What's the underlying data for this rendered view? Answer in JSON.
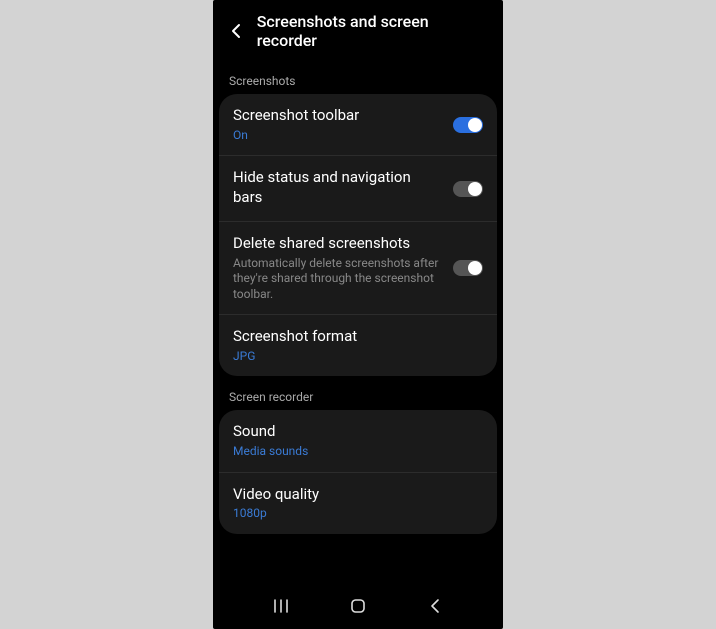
{
  "header": {
    "title": "Screenshots and screen recorder"
  },
  "sections": {
    "screenshots": {
      "label": "Screenshots",
      "toolbar": {
        "title": "Screenshot toolbar",
        "status": "On"
      },
      "hide_bars": {
        "title": "Hide status and navigation bars"
      },
      "delete_shared": {
        "title": "Delete shared screenshots",
        "desc": "Automatically delete screenshots after they're shared through the screenshot toolbar."
      },
      "format": {
        "title": "Screenshot format",
        "value": "JPG"
      }
    },
    "recorder": {
      "label": "Screen recorder",
      "sound": {
        "title": "Sound",
        "value": "Media sounds"
      },
      "quality": {
        "title": "Video quality",
        "value": "1080p"
      }
    }
  },
  "toggles": {
    "toolbar_on": true,
    "hide_bars_on": false,
    "delete_shared_on": false
  }
}
